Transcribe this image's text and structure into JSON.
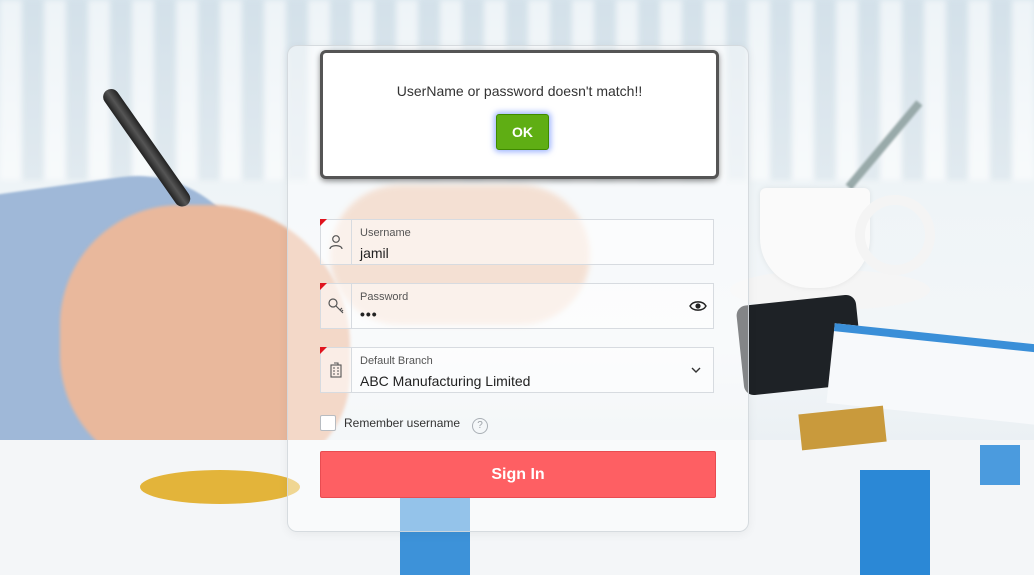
{
  "alert": {
    "message": "UserName or password doesn't match!!",
    "ok_label": "OK"
  },
  "login": {
    "username": {
      "label": "Username",
      "value": "jamil",
      "icon": "user-icon"
    },
    "password": {
      "label": "Password",
      "value": "•••",
      "icon": "key-icon",
      "toggle_icon": "eye-icon"
    },
    "branch": {
      "label": "Default Branch",
      "value": "ABC Manufacturing Limited",
      "icon": "building-icon",
      "dropdown_icon": "chevron-down-icon"
    },
    "remember_label": "Remember username",
    "help_icon": "?",
    "signin_label": "Sign In"
  },
  "colors": {
    "required_marker": "#e0141e",
    "signin_button": "#fe5f63",
    "ok_button": "#5fae14"
  }
}
